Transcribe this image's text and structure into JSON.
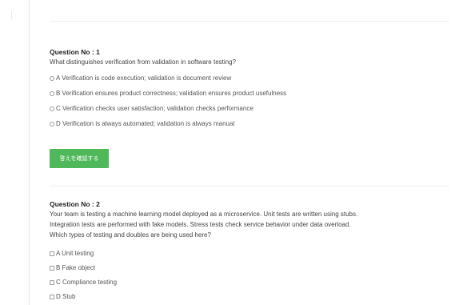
{
  "questions": [
    {
      "title": "Question No : 1",
      "lines": [
        "What distinguishes verification from validation in software testing?"
      ],
      "input_type": "radio",
      "options": [
        "A Verification is code execution; validation is document review",
        "B Verification ensures product correctness; validation ensures product usefulness",
        "C Verification checks user satisfaction; validation checks performance",
        "D Verification is always automated; validation is always manual"
      ],
      "button_label": "答えを確認する"
    },
    {
      "title": "Question No : 2",
      "lines": [
        "Your team is testing a machine learning model deployed as a microservice. Unit tests are written using stubs.",
        "Integration tests are performed with fake models. Stress tests check service behavior under data overload.",
        "Which types of testing and doubles are being used here?"
      ],
      "input_type": "checkbox",
      "options": [
        "A Unit testing",
        "B Fake object",
        "C Compliance testing",
        "D Stub"
      ]
    }
  ]
}
